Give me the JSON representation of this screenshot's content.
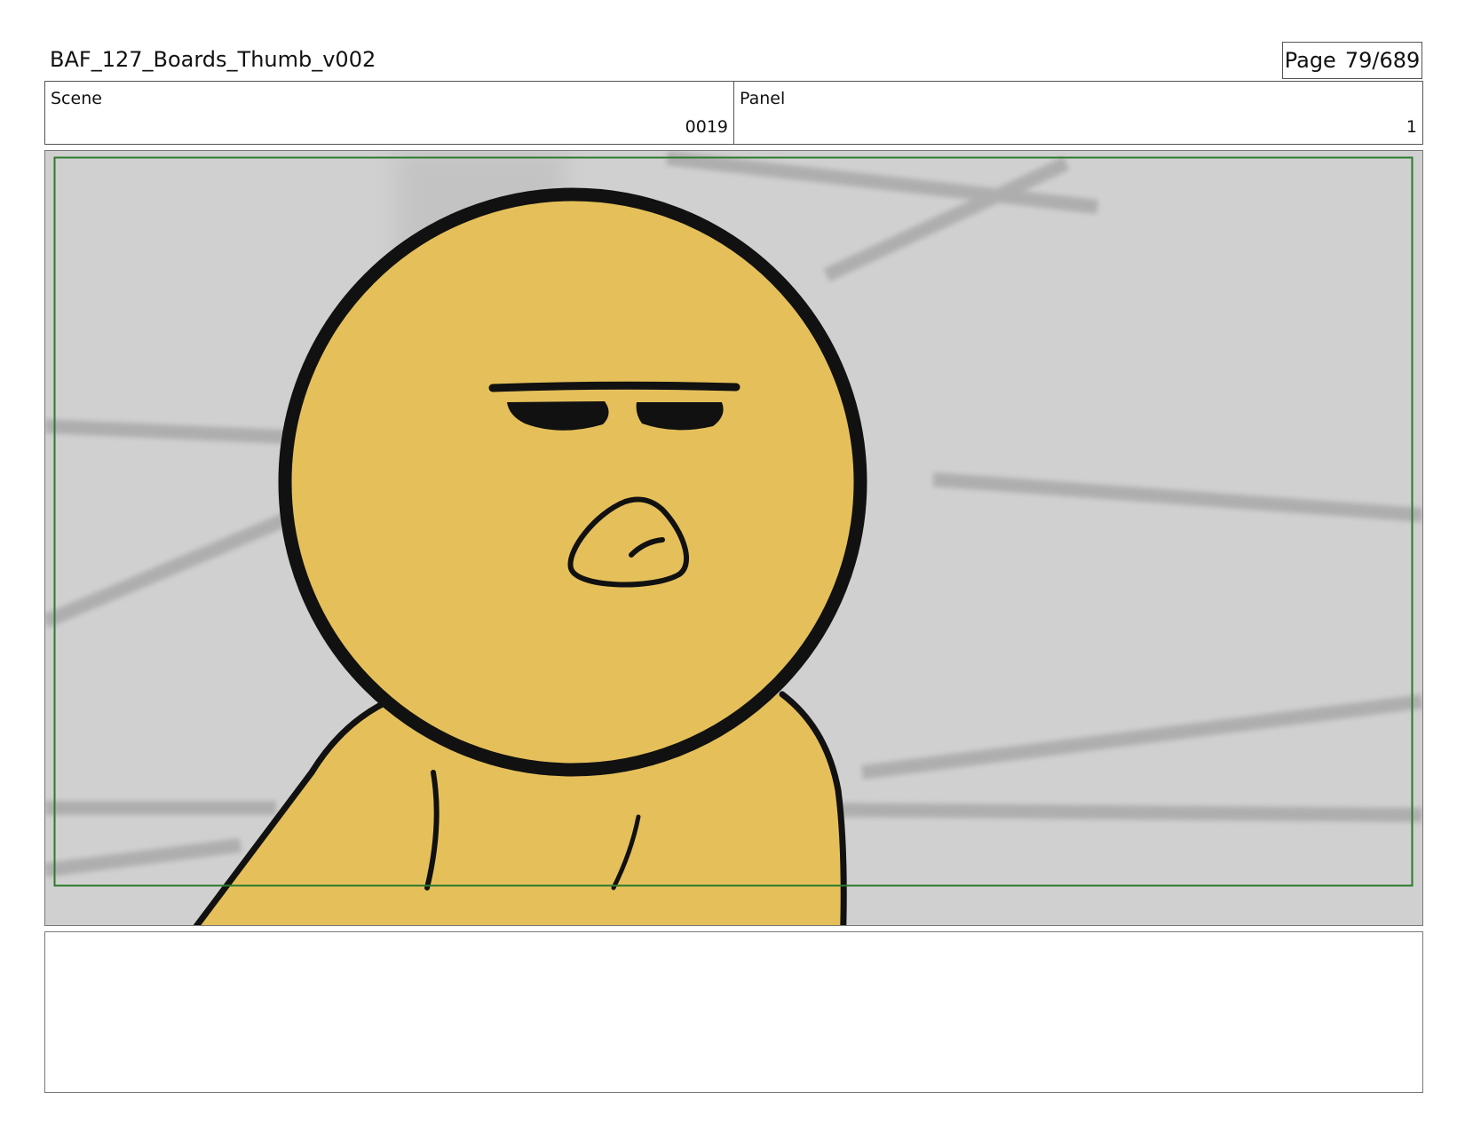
{
  "header": {
    "title": "BAF_127_Boards_Thumb_v002",
    "page_label": "Page",
    "page_number": "79/689"
  },
  "info": {
    "scene_label": "Scene",
    "scene_value": "0019",
    "panel_label": "Panel",
    "panel_value": "1"
  },
  "notes": {
    "text": ""
  },
  "colors": {
    "character_fill": "#e5c05a",
    "outline": "#111111",
    "background": "#d0d0d0",
    "safe_frame": "#2d7a2d"
  }
}
